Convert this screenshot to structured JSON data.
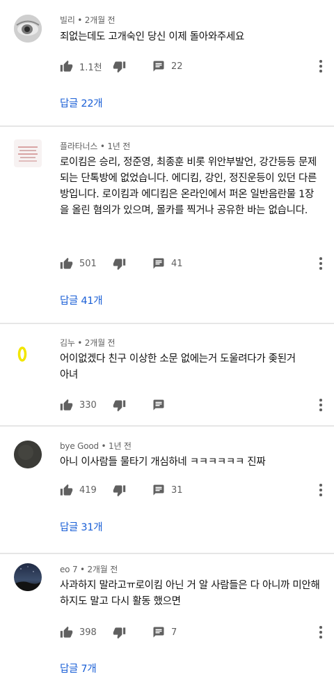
{
  "comments": [
    {
      "author": "빌리",
      "time": "2개월 전",
      "avatar_icon": "grayscale-eye-photo",
      "text": "죄없는데도 고개숙인 당신 이제 돌아와주세요",
      "likes": "1.1천",
      "reply_count": "22",
      "replies_label": "답글 22개"
    },
    {
      "author": "플라타너스",
      "time": "1년 전",
      "avatar_icon": "text-card-image",
      "text": "로이킴은 승리, 정준영, 최종훈 비롯 위안부발언, 강간등등 문제되는 단톡방에 없었습니다. 에디킴, 강인, 정진운등이 있던 다른 방입니다. 로이킴과 에디킴은 온라인에서 퍼온 일반음란물 1장을 올린 혐의가 있으며, 몰카를 찍거나 공유한 바는 없습니다.",
      "likes": "501",
      "reply_count": "41",
      "replies_label": "답글 41개"
    },
    {
      "author": "김누",
      "time": "2개월 전",
      "avatar_icon": "yellow-zero-drawing",
      "text": "어이없겠다 친구 이상한 소문 없에는거 도울려다가 좆된거아녀",
      "likes": "330",
      "reply_count": "",
      "replies_label": ""
    },
    {
      "author": "bye Good",
      "time": "1년 전",
      "avatar_icon": "dark-circle-avatar",
      "text": "아니 이사람들 물타기 개심하네 ㅋㅋㅋㅋㅋㅋ 진짜",
      "likes": "419",
      "reply_count": "31",
      "replies_label": "답글 31개"
    },
    {
      "author": "eo 7",
      "time": "2개월 전",
      "avatar_icon": "night-sky-photo",
      "text": "사과하지 말라고ㅠ로이킴 아닌 거 알 사람들은 다 아니까 미안해 하지도 말고 다시 활동 했으면",
      "likes": "398",
      "reply_count": "7",
      "replies_label": "답글 7개"
    }
  ],
  "icons": {
    "like": "thumbs-up-icon",
    "dislike": "thumbs-down-icon",
    "reply": "comment-icon",
    "more": "more-vertical-icon"
  },
  "colors": {
    "link": "#1a5fd6",
    "secondary_text": "#606060",
    "divider": "#e6e6e6"
  }
}
